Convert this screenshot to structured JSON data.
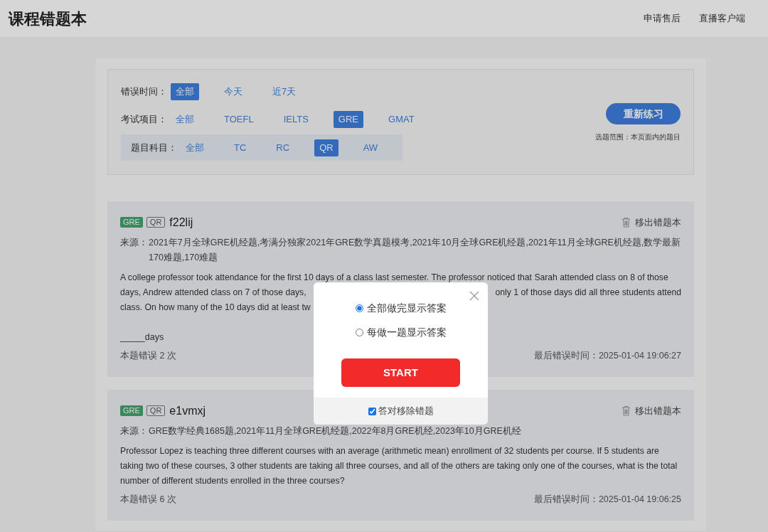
{
  "header": {
    "title": "课程错题本",
    "links": [
      "申请售后",
      "直播客户端"
    ]
  },
  "filters": [
    {
      "kind": "main",
      "label": "错误时间：",
      "options": [
        {
          "label": "全部",
          "selected": true
        },
        {
          "label": "今天",
          "selected": false
        },
        {
          "label": "近7天",
          "selected": false
        }
      ]
    },
    {
      "kind": "main",
      "label": "考试项目：",
      "options": [
        {
          "label": "全部",
          "selected": false
        },
        {
          "label": "TOEFL",
          "selected": false
        },
        {
          "label": "IELTS",
          "selected": false
        },
        {
          "label": "GRE",
          "selected": true
        },
        {
          "label": "GMAT",
          "selected": false
        }
      ]
    },
    {
      "kind": "sub",
      "label": "题目科目：",
      "options": [
        {
          "label": "全部",
          "selected": false
        },
        {
          "label": "TC",
          "selected": false
        },
        {
          "label": "RC",
          "selected": false
        },
        {
          "label": "QR",
          "selected": true
        },
        {
          "label": "AW",
          "selected": false
        }
      ]
    }
  ],
  "practice": {
    "button": "重新练习",
    "note": "选题范围：本页面内的题目"
  },
  "questions": [
    {
      "exam": "GRE",
      "subject": "QR",
      "id": "f22lij",
      "remove": "移出错题本",
      "source_label": "来源：",
      "source": "2021年7月全球GRE机经题,考满分独家2021年GRE数学真题模考,2021年10月全球GRE机经题,2021年11月全球GRE机经题,数学最新170难题,170难题",
      "lines": [
        [
          "A college professor took attendance for the first 10 days of a class last semester. The professor noticed that Sarah attended class on 8 of those"
        ],
        [
          "days, Andrew attended class on 7 of those days,",
          "only 1 of those days did all three students attend"
        ],
        [
          "class. On how many of the 10 days did at least tw"
        ]
      ],
      "blank": "_____days",
      "error_count": "本题错误 2 次",
      "last_time_label": "最后错误时间：",
      "last_time": "2025-01-04 19:06:27"
    },
    {
      "exam": "GRE",
      "subject": "QR",
      "id": "e1vmxj",
      "remove": "移出错题本",
      "source_label": "来源：",
      "source": "GRE数学经典1685题,2021年11月全球GRE机经题,2022年8月GRE机经,2023年10月GRE机经",
      "lines": [
        [
          "Professor Lopez is teaching three different courses with an average (arithmetic mean) enrollment of 32 students per course. If 5 students are"
        ],
        [
          "taking two of these courses, 3 other students are taking all three courses, and all of the others are taking only one of the courses, what is the total"
        ],
        [
          "number of different students enrolled in the three courses?"
        ]
      ],
      "error_count": "本题错误 6 次",
      "last_time_label": "最后错误时间：",
      "last_time": "2025-01-04 19:06:25"
    }
  ],
  "modal": {
    "options": [
      {
        "label": "全部做完显示答案",
        "selected": true
      },
      {
        "label": "每做一题显示答案",
        "selected": false
      }
    ],
    "start": "START",
    "remove_on_correct": {
      "label": "答对移除错题",
      "checked": true
    }
  }
}
